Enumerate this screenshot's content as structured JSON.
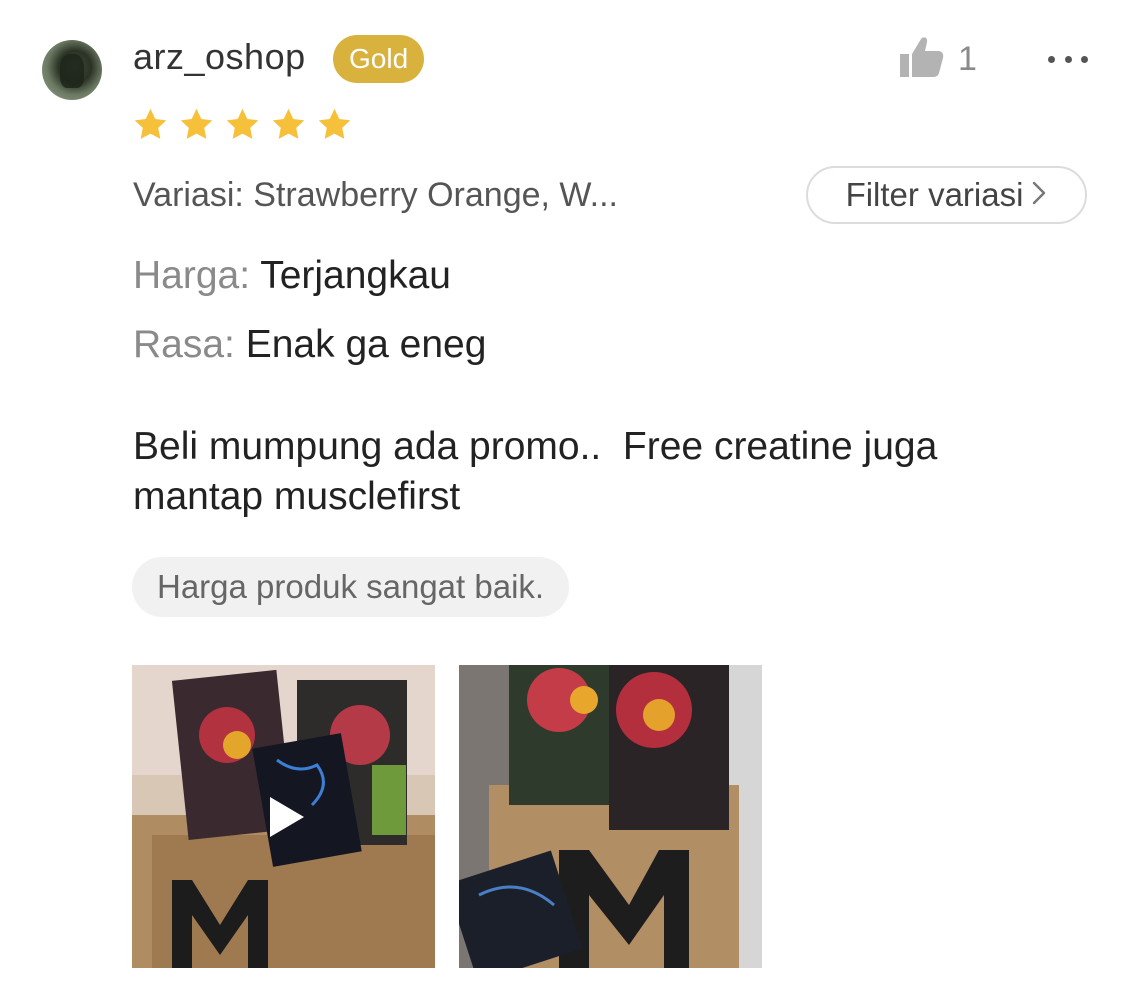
{
  "review": {
    "username": "arz_oshop",
    "badge": "Gold",
    "like_count": "1",
    "rating": 5,
    "variation": "Variasi: Strawberry Orange, W...",
    "filter_button": "Filter variasi",
    "attributes": [
      {
        "key": "Harga:",
        "value": "Terjangkau"
      },
      {
        "key": "Rasa:",
        "value": "Enak ga eneg"
      }
    ],
    "text": "Beli mumpung ada promo..  Free creatine juga mantap musclefirst",
    "tag": "Harga produk sangat baik.",
    "media": [
      {
        "type": "video",
        "icon": "play-icon"
      },
      {
        "type": "image"
      }
    ]
  },
  "icons": {
    "like": "thumbs-up-icon",
    "more": "more-dots-icon",
    "star": "star-icon",
    "chevron": "chevron-right-icon"
  },
  "colors": {
    "badge": "#d9b13d",
    "star": "#f6c03b",
    "muted": "#8a8a8a",
    "tag_bg": "#f1f1f1"
  }
}
